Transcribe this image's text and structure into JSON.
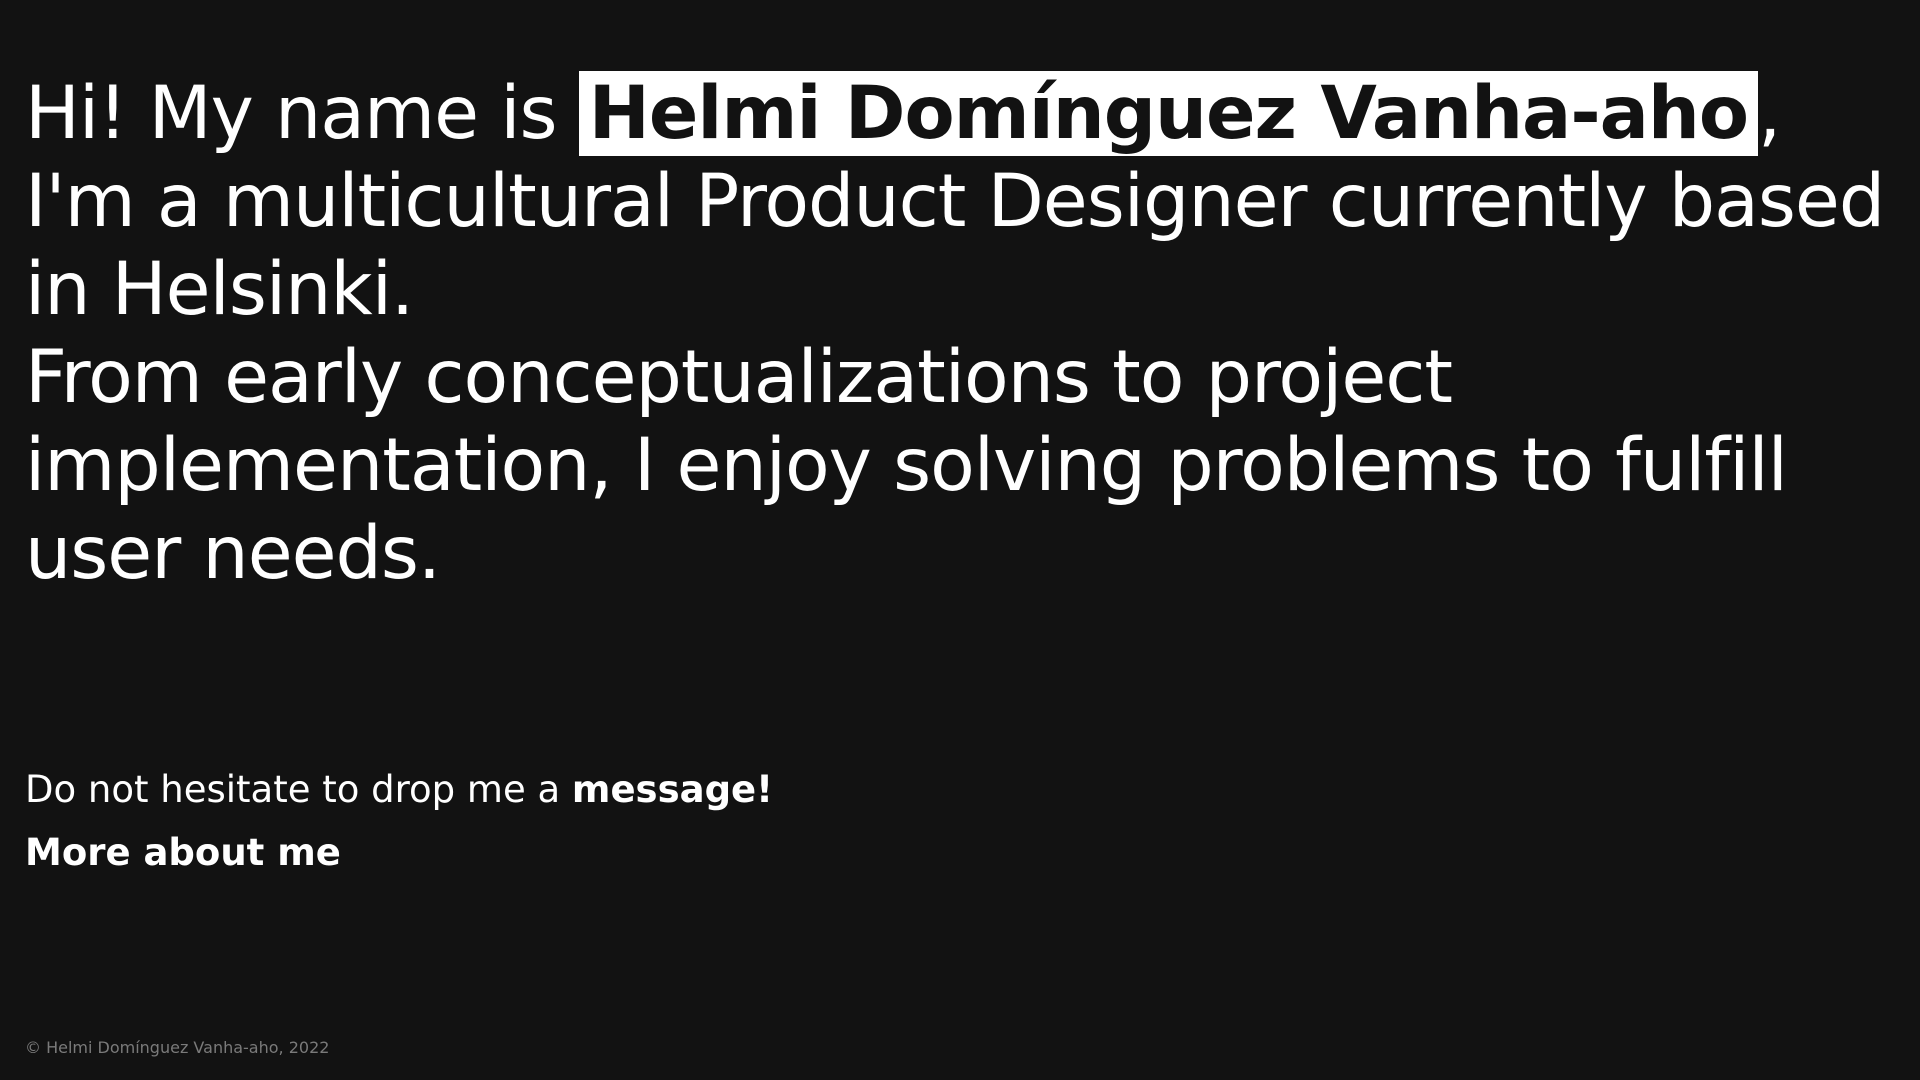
{
  "intro": {
    "greeting": "Hi! My name is ",
    "name": "Helmi Domínguez Vanha-aho",
    "after_name": ",",
    "line2": "I'm a multicultural Product Designer currently based",
    "line3": "in Helsinki.",
    "line4": "From early conceptualizations to project",
    "line5": "implementation, I enjoy solving problems to fulfill",
    "line6": "user needs."
  },
  "contact": {
    "prefix": "Do not hesitate to drop me a ",
    "link_label": "message!"
  },
  "more_link": "More about me",
  "footer": {
    "copyright": "© Helmi Domínguez Vanha-aho, 2022"
  },
  "colors": {
    "background": "#121212",
    "text": "#ffffff",
    "highlight_bg": "#ffffff",
    "footer_text": "#7a7a7a"
  }
}
